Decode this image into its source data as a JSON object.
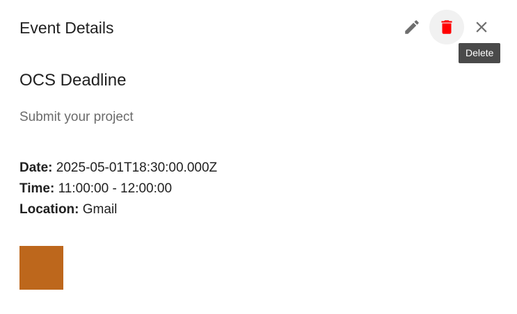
{
  "header": {
    "title": "Event Details"
  },
  "toolbar": {
    "edit_icon": "pencil-icon",
    "delete_icon": "trash-icon",
    "close_icon": "close-icon",
    "tooltip": "Delete",
    "delete_color": "#ff0000",
    "icon_color": "#6e6e6e"
  },
  "event": {
    "title": "OCS Deadline",
    "description": "Submit your project",
    "date_label": "Date:",
    "date_value": "2025-05-01T18:30:00.000Z",
    "time_label": "Time:",
    "time_value": "11:00:00 - 12:00:00",
    "location_label": "Location:",
    "location_value": "Gmail",
    "color": "#bd671c"
  }
}
